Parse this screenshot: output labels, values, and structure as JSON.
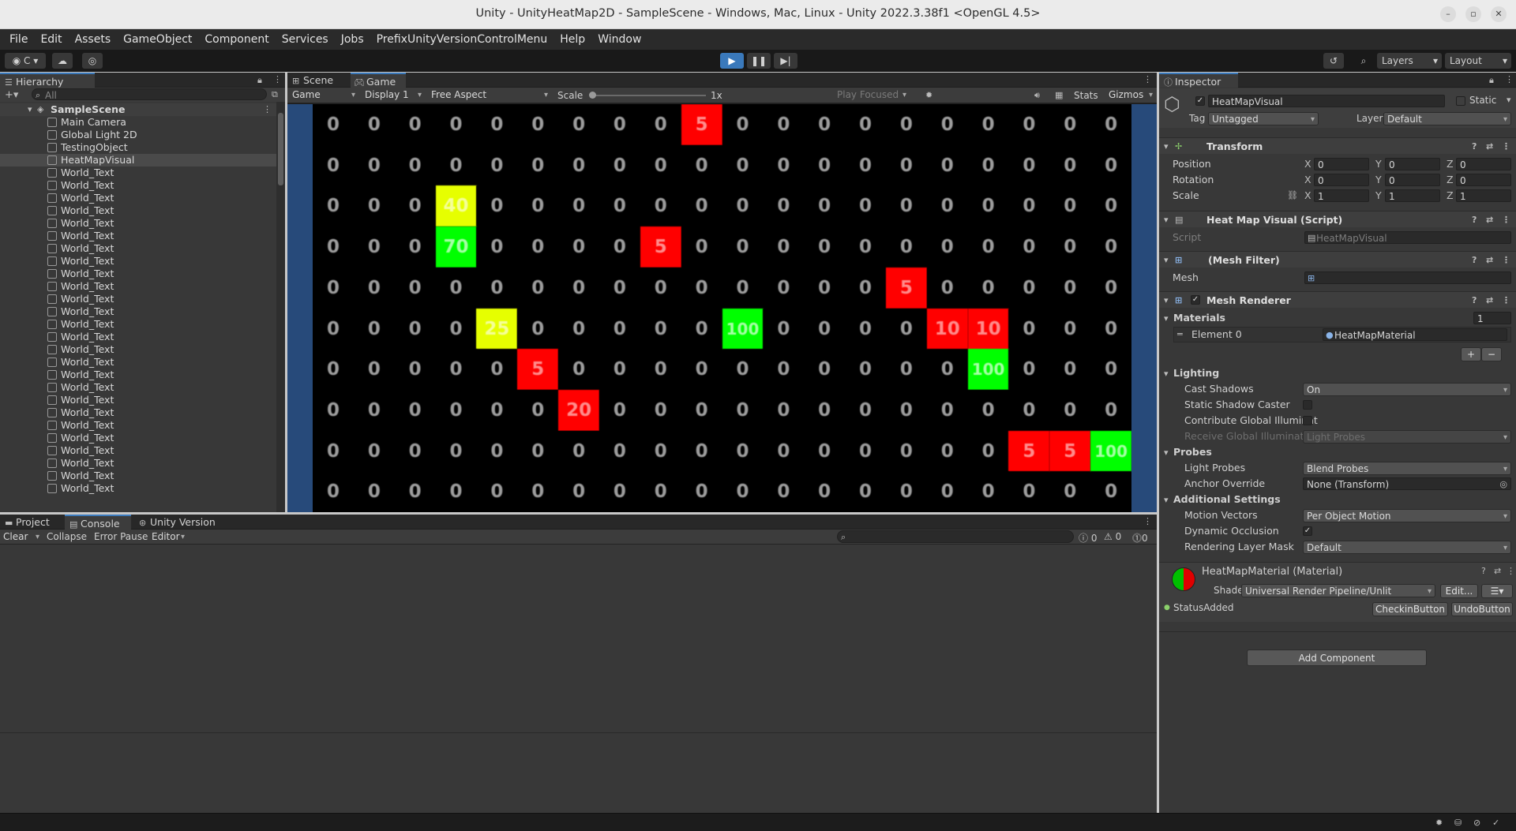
{
  "window": {
    "title": "Unity - UnityHeatMap2D - SampleScene - Windows, Mac, Linux - Unity 2022.3.38f1 <OpenGL 4.5>"
  },
  "menu": [
    "File",
    "Edit",
    "Assets",
    "GameObject",
    "Component",
    "Services",
    "Jobs",
    "PrefixUnityVersionControlMenu",
    "Help",
    "Window"
  ],
  "toolbar": {
    "account_label": "C",
    "layers_label": "Layers",
    "layout_label": "Layout"
  },
  "hierarchy": {
    "tab_label": "Hierarchy",
    "search_placeholder": "All",
    "scene_name": "SampleScene",
    "items": [
      "Main Camera",
      "Global Light 2D",
      "TestingObject",
      "HeatMapVisual",
      "World_Text",
      "World_Text",
      "World_Text",
      "World_Text",
      "World_Text",
      "World_Text",
      "World_Text",
      "World_Text",
      "World_Text",
      "World_Text",
      "World_Text",
      "World_Text",
      "World_Text",
      "World_Text",
      "World_Text",
      "World_Text",
      "World_Text",
      "World_Text",
      "World_Text",
      "World_Text",
      "World_Text",
      "World_Text",
      "World_Text",
      "World_Text",
      "World_Text",
      "World_Text"
    ],
    "selected_index": 3
  },
  "game_view": {
    "tabs": [
      "Scene",
      "Game"
    ],
    "active_tab": "Game",
    "game_dropdown": "Game",
    "display_dropdown": "Display 1",
    "aspect_dropdown": "Free Aspect",
    "scale_label": "Scale",
    "scale_value": "1x",
    "play_focused": "Play Focused",
    "stats_label": "Stats",
    "gizmos_label": "Gizmos",
    "grid": [
      [
        0,
        0,
        0,
        0,
        0,
        0,
        0,
        0,
        0,
        5,
        0,
        0,
        0,
        0,
        0,
        0,
        0,
        0,
        0,
        0
      ],
      [
        0,
        0,
        0,
        0,
        0,
        0,
        0,
        0,
        0,
        0,
        0,
        0,
        0,
        0,
        0,
        0,
        0,
        0,
        0,
        0
      ],
      [
        0,
        0,
        0,
        40,
        0,
        0,
        0,
        0,
        0,
        0,
        0,
        0,
        0,
        0,
        0,
        0,
        0,
        0,
        0,
        0
      ],
      [
        0,
        0,
        0,
        70,
        0,
        0,
        0,
        0,
        5,
        0,
        0,
        0,
        0,
        0,
        0,
        0,
        0,
        0,
        0,
        0
      ],
      [
        0,
        0,
        0,
        0,
        0,
        0,
        0,
        0,
        0,
        0,
        0,
        0,
        0,
        0,
        5,
        0,
        0,
        0,
        0,
        0
      ],
      [
        0,
        0,
        0,
        0,
        25,
        0,
        0,
        0,
        0,
        0,
        100,
        0,
        0,
        0,
        0,
        10,
        10,
        0,
        0,
        0
      ],
      [
        0,
        0,
        0,
        0,
        0,
        5,
        0,
        0,
        0,
        0,
        0,
        0,
        0,
        0,
        0,
        0,
        100,
        0,
        0,
        0
      ],
      [
        0,
        0,
        0,
        0,
        0,
        0,
        20,
        0,
        0,
        0,
        0,
        0,
        0,
        0,
        0,
        0,
        0,
        0,
        0,
        0
      ],
      [
        0,
        0,
        0,
        0,
        0,
        0,
        0,
        0,
        0,
        0,
        0,
        0,
        0,
        0,
        0,
        0,
        0,
        5,
        5,
        100
      ],
      [
        0,
        0,
        0,
        0,
        0,
        0,
        0,
        0,
        0,
        0,
        0,
        0,
        0,
        0,
        0,
        0,
        0,
        0,
        0,
        0
      ]
    ],
    "colors": {
      "low": "#ff0000",
      "mid": "#e6ff00",
      "high": "#00ff00",
      "zero": "#000000",
      "letterbox": "#274a7a"
    }
  },
  "console": {
    "tabs": [
      "Project",
      "Console",
      "Unity Version Control"
    ],
    "active_tab": "Console",
    "clear_label": "Clear",
    "collapse_label": "Collapse",
    "error_pause_label": "Error Pause",
    "editor_label": "Editor",
    "counts": {
      "info": "0",
      "warnings": "0",
      "errors": "0"
    }
  },
  "inspector": {
    "tab_label": "Inspector",
    "object_name": "HeatMapVisual",
    "static_label": "Static",
    "tag_label": "Tag",
    "tag_value": "Untagged",
    "layer_label": "Layer",
    "layer_value": "Default",
    "transform": {
      "title": "Transform",
      "rows": [
        {
          "label": "Position",
          "x": "0",
          "y": "0",
          "z": "0"
        },
        {
          "label": "Rotation",
          "x": "0",
          "y": "0",
          "z": "0"
        },
        {
          "label": "Scale",
          "x": "1",
          "y": "1",
          "z": "1"
        }
      ]
    },
    "heatmap_script": {
      "title": "Heat Map Visual (Script)",
      "script_label": "Script",
      "script_value": "HeatMapVisual"
    },
    "mesh_filter": {
      "title": "(Mesh Filter)",
      "mesh_label": "Mesh"
    },
    "mesh_renderer": {
      "title": "Mesh Renderer",
      "materials_label": "Materials",
      "materials_count": "1",
      "element_label": "Element 0",
      "element_value": "HeatMapMaterial",
      "lighting_label": "Lighting",
      "cast_shadows_label": "Cast Shadows",
      "cast_shadows_value": "On",
      "static_shadow_label": "Static Shadow Caster",
      "contribute_gi_label": "Contribute Global Illuminat",
      "receive_gi_label": "Receive Global Illuminatior",
      "receive_gi_value": "Light Probes",
      "probes_label": "Probes",
      "light_probes_label": "Light Probes",
      "light_probes_value": "Blend Probes",
      "anchor_label": "Anchor Override",
      "anchor_value": "None (Transform)",
      "additional_label": "Additional Settings",
      "motion_label": "Motion Vectors",
      "motion_value": "Per Object Motion",
      "dynamic_occlusion_label": "Dynamic Occlusion",
      "rendering_layer_label": "Rendering Layer Mask",
      "rendering_layer_value": "Default"
    },
    "material": {
      "title": "HeatMapMaterial (Material)",
      "shader_label": "Shader",
      "shader_value": "Universal Render Pipeline/Unlit",
      "edit_label": "Edit...",
      "status_label": "StatusAdded",
      "checkin_label": "CheckinButton",
      "undo_label": "UndoButton"
    },
    "add_component_label": "Add Component"
  }
}
